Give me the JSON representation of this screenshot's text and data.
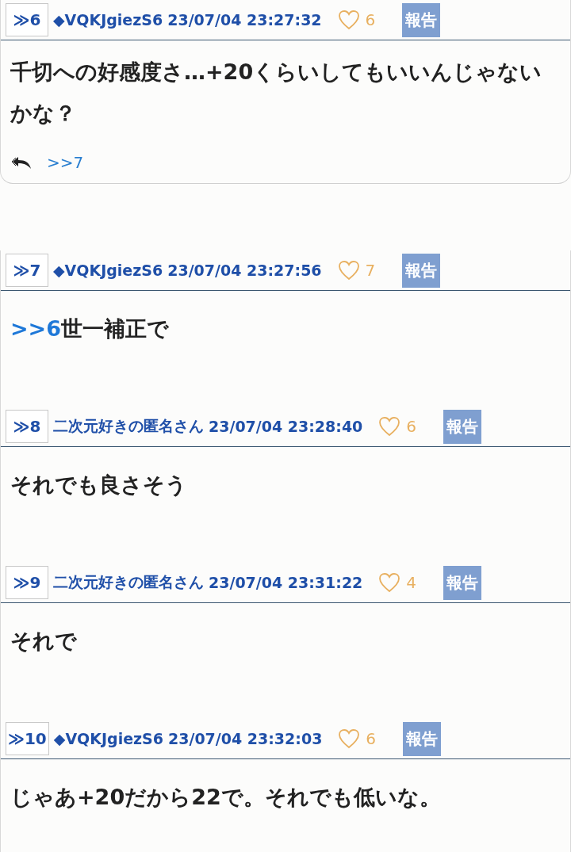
{
  "posts": [
    {
      "number": "≫6",
      "author": "◆VQKJgiezS6",
      "date": "23/07/04 23:27:32",
      "likes": "6",
      "report": "報告",
      "body": "千切への好感度さ…+20くらいしてもいいんじゃないかな？",
      "replies": [
        ">>7"
      ]
    },
    {
      "number": "≫7",
      "author": "◆VQKJgiezS6",
      "date": "23/07/04 23:27:56",
      "likes": "7",
      "report": "報告",
      "anchor": ">>6",
      "body": "世一補正で"
    },
    {
      "number": "≫8",
      "author": "二次元好きの匿名さん",
      "date": "23/07/04 23:28:40",
      "likes": "6",
      "report": "報告",
      "body": "それでも良さそう"
    },
    {
      "number": "≫9",
      "author": "二次元好きの匿名さん",
      "date": "23/07/04 23:31:22",
      "likes": "4",
      "report": "報告",
      "body": "それで"
    },
    {
      "number": "≫10",
      "author": "◆VQKJgiezS6",
      "date": "23/07/04 23:32:03",
      "likes": "6",
      "report": "報告",
      "body": "じゃあ+20だから22で。それでも低いな。"
    }
  ]
}
